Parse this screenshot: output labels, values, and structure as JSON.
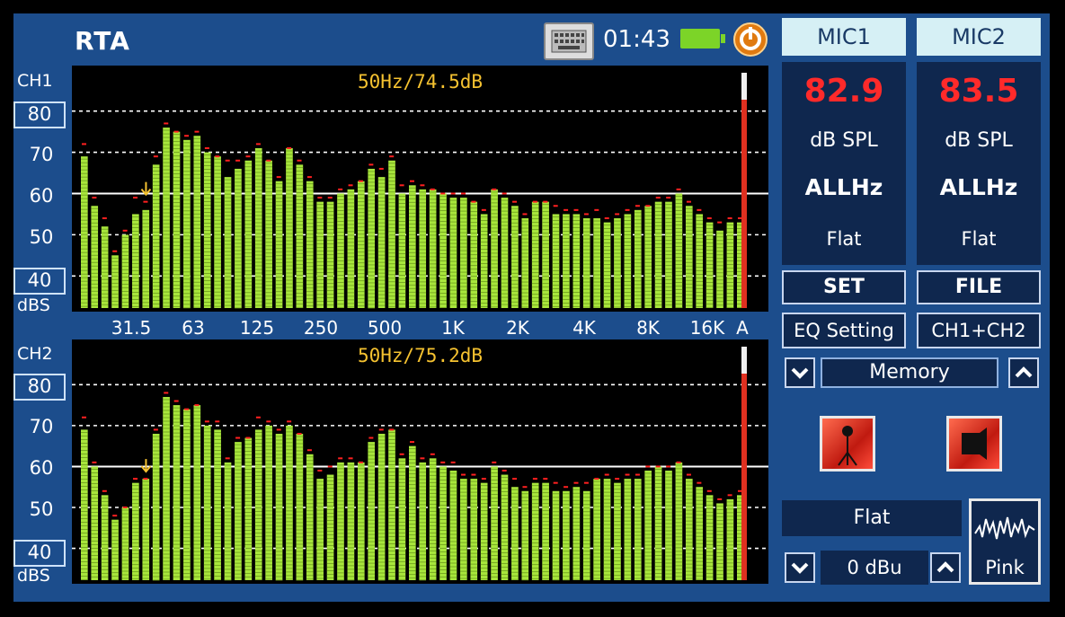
{
  "app": {
    "title": "RTA",
    "time": "01:43"
  },
  "colors": {
    "bar": "#a8e63c",
    "peak": "#ff2020",
    "readout": "#f5c230",
    "panel": "#1c4d8c",
    "value": "#ff2a2a"
  },
  "channels": [
    {
      "name": "CH1",
      "readout": "50Hz/74.5dB",
      "y_labels": [
        "80",
        "70",
        "60",
        "50",
        "40"
      ],
      "unit": "dBS",
      "peak_band": 6,
      "levels": [
        69,
        57,
        52,
        45,
        50,
        55,
        56,
        67,
        76,
        75,
        73,
        74,
        70,
        69,
        64,
        66,
        68,
        71,
        68,
        63,
        71,
        67,
        63,
        58,
        58,
        60,
        61,
        63,
        66,
        64,
        68,
        60,
        62,
        61,
        61,
        60,
        59,
        59,
        58,
        55,
        61,
        59,
        57,
        54,
        58,
        58,
        55,
        55,
        55,
        54,
        54,
        53,
        54,
        55,
        56,
        57,
        58,
        58,
        60,
        57,
        55,
        53,
        51,
        53,
        53
      ],
      "peaks": [
        72,
        59,
        54,
        46,
        51,
        59,
        58,
        69,
        77,
        75,
        74,
        75,
        71,
        69,
        68,
        68,
        69,
        72,
        68,
        64,
        71,
        68,
        64,
        59,
        59,
        61,
        62,
        63,
        67,
        66,
        69,
        62,
        63,
        62,
        61,
        60,
        60,
        60,
        58,
        56,
        61,
        60,
        58,
        55,
        58,
        58,
        57,
        56,
        56,
        55,
        56,
        54,
        55,
        56,
        57,
        57,
        59,
        59,
        61,
        58,
        56,
        54,
        53,
        54,
        54
      ],
      "frequency_labels": [
        "31.5",
        "63",
        "125",
        "250",
        "500",
        "1K",
        "2K",
        "4K",
        "8K",
        "16K",
        "A"
      ]
    },
    {
      "name": "CH2",
      "readout": "50Hz/75.2dB",
      "y_labels": [
        "80",
        "70",
        "60",
        "50",
        "40"
      ],
      "unit": "dBS",
      "peak_band": 6,
      "levels": [
        69,
        60,
        53,
        47,
        50,
        56,
        57,
        68,
        77,
        75,
        74,
        75,
        70,
        69,
        61,
        66,
        67,
        69,
        70,
        68,
        70,
        68,
        63,
        57,
        58,
        61,
        61,
        61,
        66,
        68,
        69,
        62,
        65,
        61,
        62,
        60,
        59,
        57,
        57,
        56,
        60,
        58,
        55,
        54,
        56,
        56,
        54,
        54,
        55,
        54,
        57,
        57,
        56,
        57,
        57,
        59,
        60,
        59,
        61,
        57,
        55,
        53,
        51,
        52,
        53
      ],
      "peaks": [
        72,
        61,
        54,
        48,
        50,
        57,
        57,
        69,
        78,
        76,
        74,
        75,
        71,
        71,
        62,
        67,
        67,
        72,
        71,
        69,
        71,
        68,
        64,
        59,
        60,
        62,
        62,
        61,
        67,
        69,
        69,
        63,
        66,
        62,
        63,
        61,
        61,
        58,
        58,
        57,
        61,
        59,
        57,
        55,
        57,
        57,
        56,
        55,
        56,
        56,
        57,
        58,
        57,
        58,
        58,
        60,
        60,
        60,
        61,
        58,
        56,
        54,
        52,
        53,
        54
      ],
      "frequency_labels": []
    }
  ],
  "mics": [
    {
      "label": "MIC1",
      "value": "82.9",
      "unit": "dB SPL",
      "frequency": "ALLHz",
      "weighting": "Flat"
    },
    {
      "label": "MIC2",
      "value": "83.5",
      "unit": "dB SPL",
      "frequency": "ALLHz",
      "weighting": "Flat"
    }
  ],
  "buttons": {
    "set": "SET",
    "file": "FILE",
    "eq": "EQ Setting",
    "chsum": "CH1+CH2"
  },
  "memory": {
    "label": "Memory"
  },
  "generator": {
    "weighting": "Flat",
    "level": "0 dBu",
    "signal": "Pink"
  }
}
